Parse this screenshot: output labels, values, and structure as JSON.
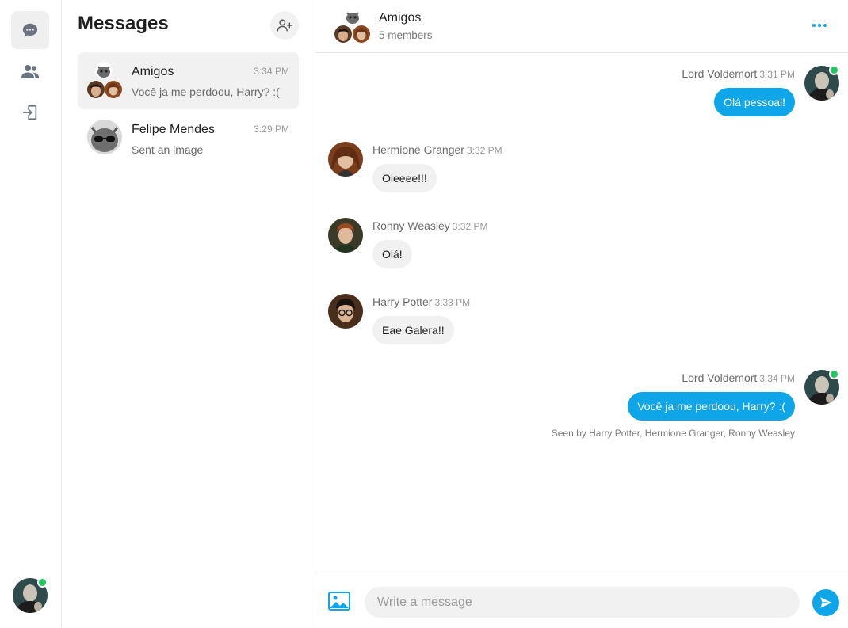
{
  "accent": "#0ea5e9",
  "online_color": "#22c55e",
  "rail": {
    "items": [
      {
        "icon": "chat-bubble-icon",
        "active": true
      },
      {
        "icon": "users-icon",
        "active": false
      },
      {
        "icon": "logout-icon",
        "active": false
      }
    ],
    "current_user": {
      "name": "Lord Voldemort",
      "online": true
    }
  },
  "list": {
    "title": "Messages",
    "add_icon": "add-user-icon",
    "conversations": [
      {
        "name": "Amigos",
        "time": "3:34 PM",
        "preview": "Você ja me perdoou, Harry? :(",
        "active": true,
        "type": "group"
      },
      {
        "name": "Felipe Mendes",
        "time": "3:29 PM",
        "preview": "Sent an image",
        "active": false,
        "type": "direct"
      }
    ]
  },
  "chat": {
    "title": "Amigos",
    "subtitle": "5 members",
    "messages": [
      {
        "author": "Lord Voldemort",
        "time": "3:31 PM",
        "text": "Olá pessoal!",
        "outgoing": true
      },
      {
        "author": "Hermione Granger",
        "time": "3:32 PM",
        "text": "Oieeee!!!",
        "outgoing": false
      },
      {
        "author": "Ronny Weasley",
        "time": "3:32 PM",
        "text": "Olá!",
        "outgoing": false
      },
      {
        "author": "Harry Potter",
        "time": "3:33 PM",
        "text": "Eae Galera!!",
        "outgoing": false
      },
      {
        "author": "Lord Voldemort",
        "time": "3:34 PM",
        "text": "Você ja me perdoou, Harry? :(",
        "outgoing": true
      }
    ],
    "seen": "Seen by Harry Potter, Hermione Granger, Ronny Weasley",
    "composer": {
      "placeholder": "Write a message",
      "value": ""
    }
  }
}
